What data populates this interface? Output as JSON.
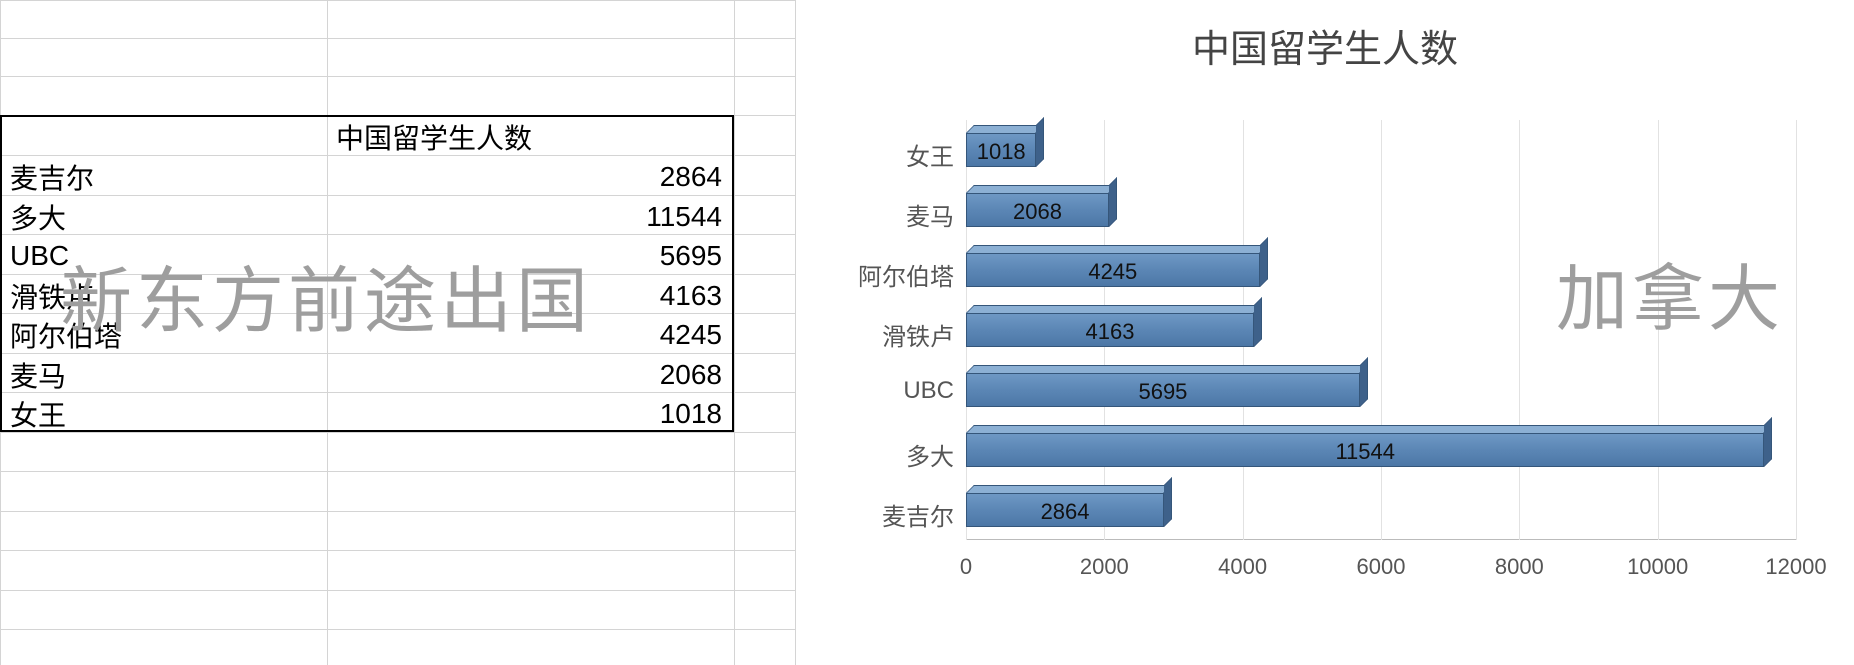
{
  "sheet": {
    "header": "中国留学生人数",
    "rows": [
      {
        "name": "麦吉尔",
        "value": 2864
      },
      {
        "name": "多大",
        "value": 11544
      },
      {
        "name": "UBC",
        "value": 5695
      },
      {
        "name": "滑铁卢",
        "value": 4163
      },
      {
        "name": "阿尔伯塔",
        "value": 4245
      },
      {
        "name": "麦马",
        "value": 2068
      },
      {
        "name": "女王",
        "value": 1018
      }
    ],
    "watermark": "新东方前途出国"
  },
  "chart_data": {
    "type": "bar",
    "orientation": "horizontal",
    "title": "中国留学生人数",
    "categories": [
      "麦吉尔",
      "多大",
      "UBC",
      "滑铁卢",
      "阿尔伯塔",
      "麦马",
      "女王"
    ],
    "values": [
      2864,
      11544,
      5695,
      4163,
      4245,
      2068,
      1018
    ],
    "xlabel": "",
    "ylabel": "",
    "xlim": [
      0,
      12000
    ],
    "x_ticks": [
      0,
      2000,
      4000,
      6000,
      8000,
      10000,
      12000
    ],
    "watermark": "加拿大"
  }
}
